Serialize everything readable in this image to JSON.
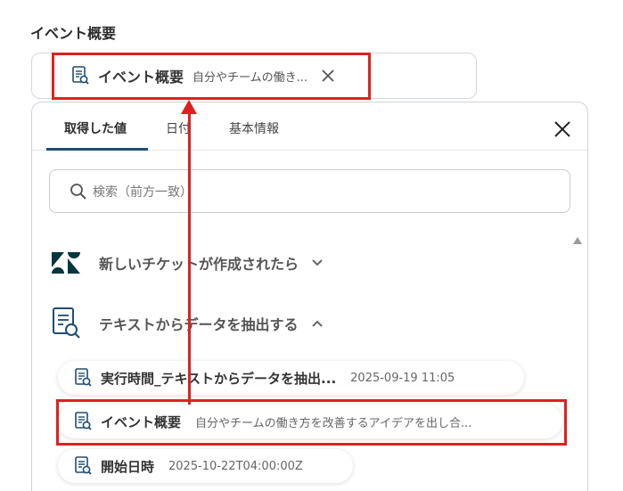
{
  "field": {
    "label": "イベント概要",
    "selected": {
      "title": "イベント概要",
      "desc": "自分やチームの働き...",
      "icon": "document-search-icon"
    }
  },
  "panel": {
    "tabs": [
      "取得した値",
      "日付",
      "基本情報"
    ],
    "active_tab": 0,
    "search_placeholder": "検索（前方一致）",
    "sections": [
      {
        "label": "新しいチケットが作成されたら",
        "icon": "zendesk-logo-icon",
        "expanded": false
      },
      {
        "label": "テキストからデータを抽出する",
        "icon": "document-search-icon",
        "expanded": true
      }
    ],
    "items": [
      {
        "title": "実行時間_テキストからデータを抽出...",
        "desc": "2025-09-19 11:05"
      },
      {
        "title": "イベント概要",
        "desc": "自分やチームの働き方を改善するアイデアを出し合..."
      },
      {
        "title": "開始日時",
        "desc": "2025-10-22T04:00:00Z"
      }
    ]
  },
  "colors": {
    "accent": "#1f4d73",
    "annotation": "#e02020",
    "zendesk": "#03363d"
  }
}
